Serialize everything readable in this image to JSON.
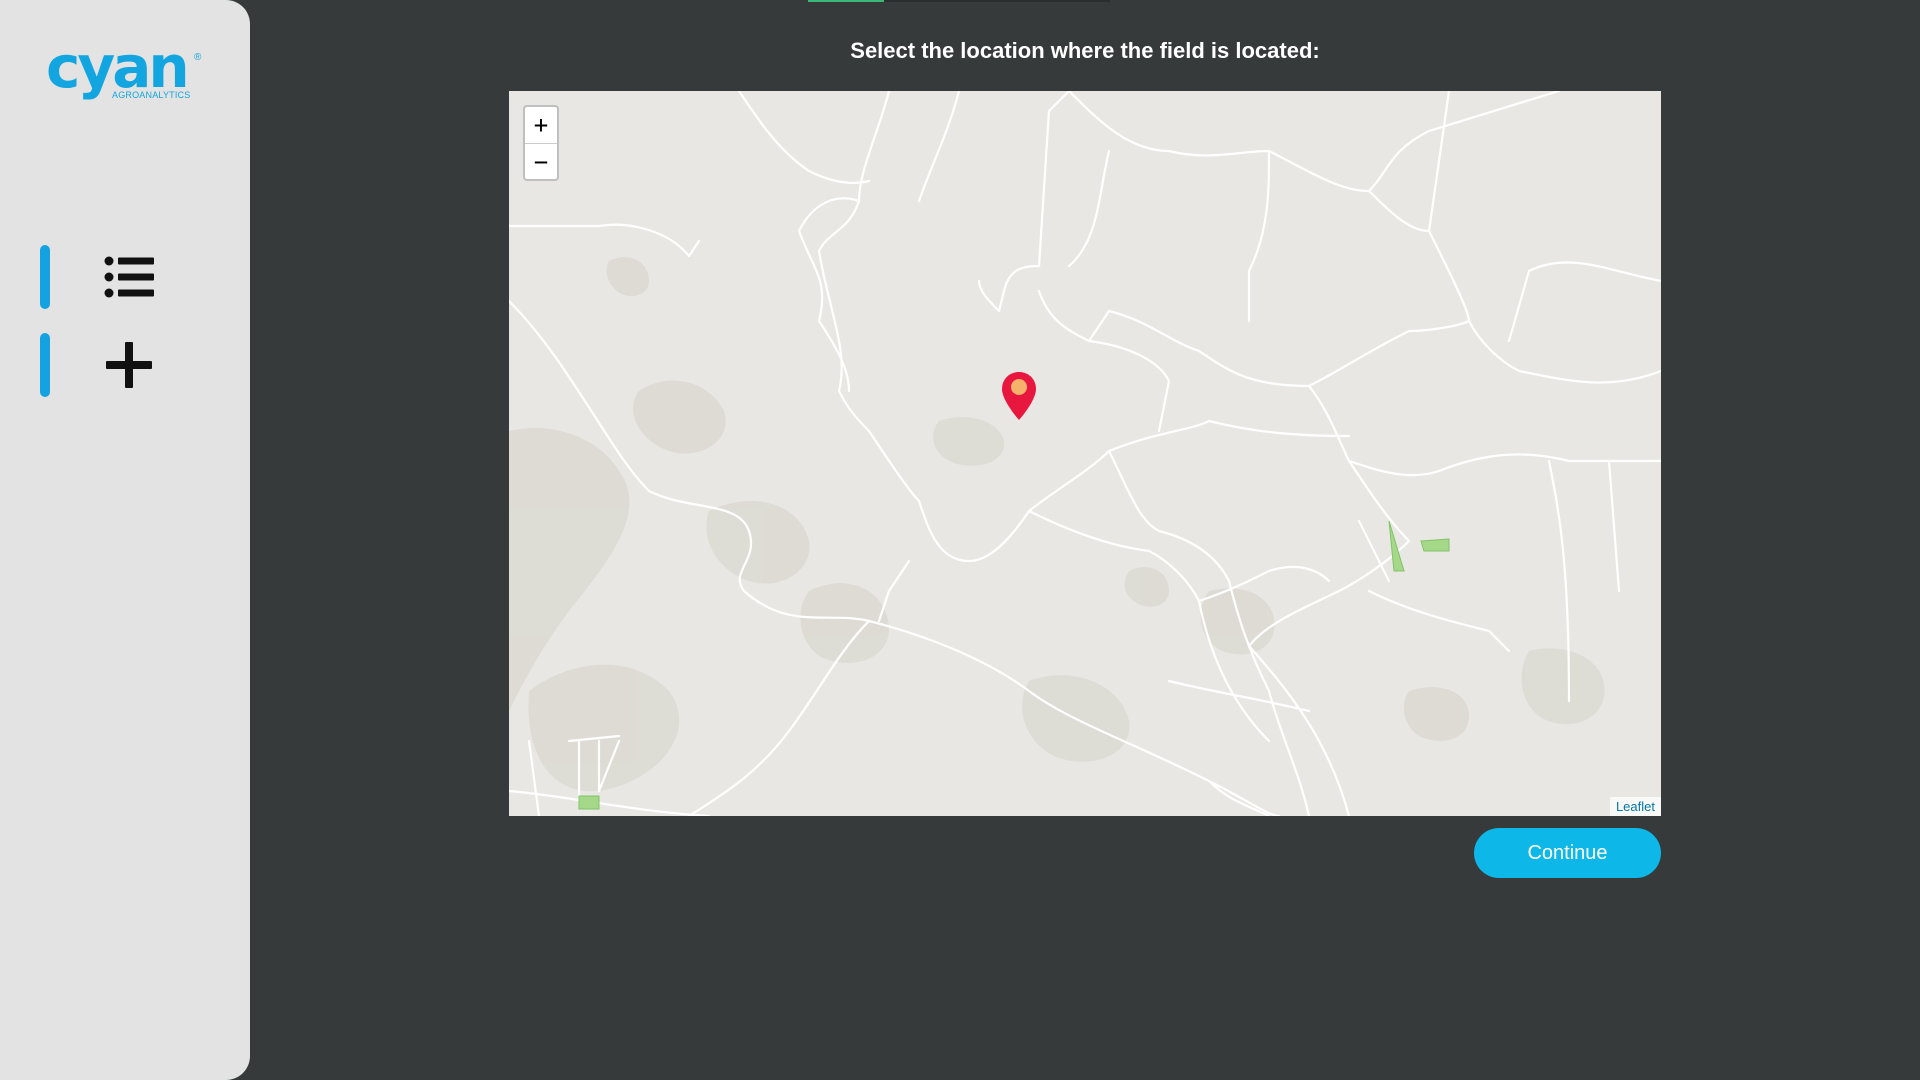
{
  "brand": {
    "name": "cyan",
    "registered_mark": "®",
    "tagline": "AGROANALYTICS",
    "color": "#12a5e0"
  },
  "sidebar": {
    "items": [
      {
        "icon": "list-icon",
        "active": true
      },
      {
        "icon": "plus-icon",
        "active": true
      }
    ],
    "accent": "#14a3e0"
  },
  "wizard": {
    "progress": 0.25,
    "progress_color": "#3bb878"
  },
  "page": {
    "title": "Select the location where the field is located:"
  },
  "map": {
    "zoom_in_label": "+",
    "zoom_out_label": "−",
    "attribution": "Leaflet",
    "marker_icon": "map-pin-icon",
    "marker_color": "#e8173f"
  },
  "actions": {
    "continue_label": "Continue",
    "continue_color": "#0db7e8"
  }
}
